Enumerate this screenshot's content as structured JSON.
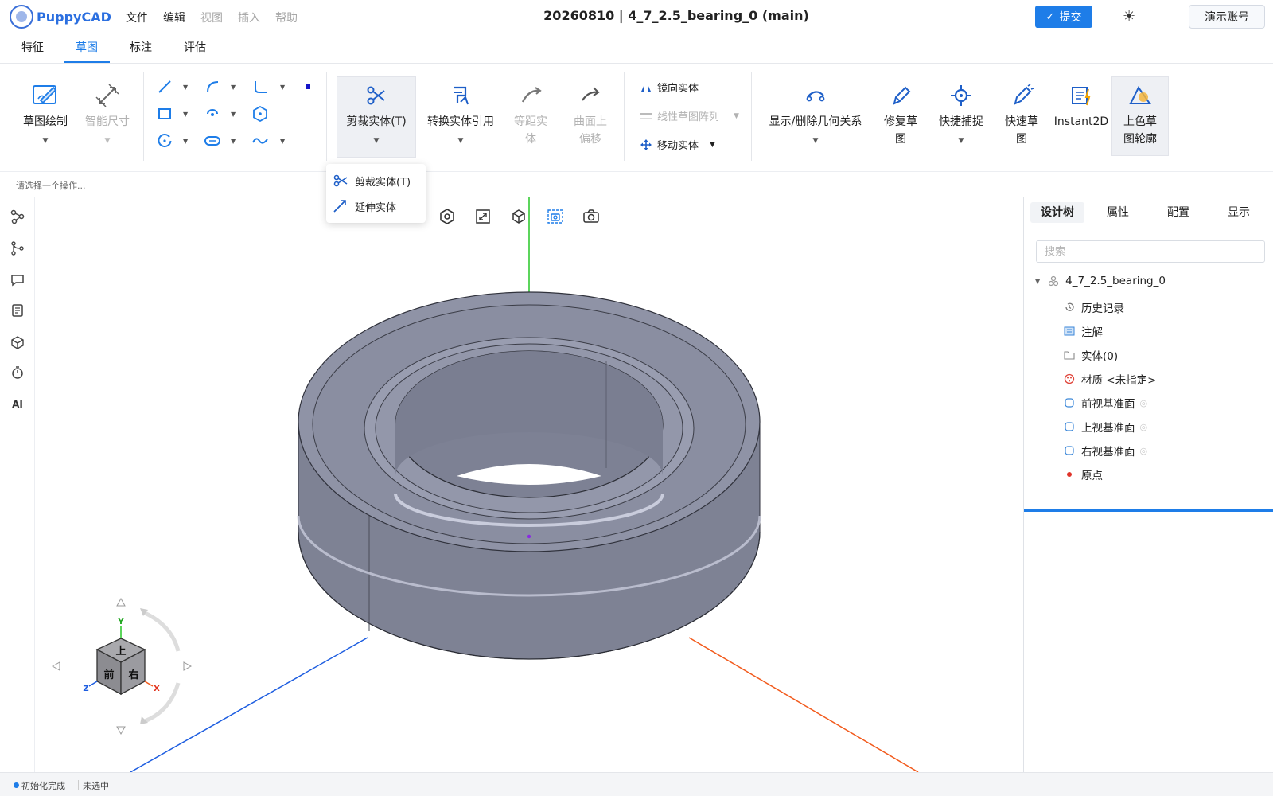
{
  "app": {
    "name": "PuppyCAD",
    "doc_title": "20260810 | 4_7_2.5_bearing_0  (main)"
  },
  "menu": [
    {
      "label": "文件",
      "enabled": true
    },
    {
      "label": "编辑",
      "enabled": true
    },
    {
      "label": "视图",
      "enabled": false
    },
    {
      "label": "插入",
      "enabled": false
    },
    {
      "label": "帮助",
      "enabled": false
    }
  ],
  "header": {
    "submit_label": "提交",
    "account_label": "演示账号",
    "theme_icon": "sun-icon"
  },
  "tabs": [
    {
      "label": "特征",
      "active": false
    },
    {
      "label": "草图",
      "active": true
    },
    {
      "label": "标注",
      "active": false
    },
    {
      "label": "评估",
      "active": false
    }
  ],
  "ribbon": {
    "sketch_draw": "草图绘制",
    "smart_dim": "智能尺寸",
    "trim": "剪裁实体(T)",
    "convert": "转换实体引用",
    "offset_line1": "等距实",
    "offset_line2": "体",
    "surface_line1": "曲面上",
    "surface_line2": "偏移",
    "mirror": "镜向实体",
    "linear_pattern": "线性草图阵列",
    "move": "移动实体",
    "relations": "显示/删除几何关系",
    "repair_line1": "修复草",
    "repair_line2": "图",
    "quick_snap": "快捷捕捉",
    "rapid_line1": "快速草",
    "rapid_line2": "图",
    "instant2d": "Instant2D",
    "colorize_line1": "上色草",
    "colorize_line2": "图轮廓"
  },
  "dropdown": {
    "items": [
      "剪裁实体(T)",
      "延伸实体"
    ]
  },
  "prompt": "请选择一个操作...",
  "left_tools": [
    "sketch-tree-icon",
    "branch-icon",
    "comment-icon",
    "list-icon",
    "part-icon",
    "timer-icon",
    "AI"
  ],
  "viewport": {
    "tools": [
      "view-orient-icon",
      "fit-icon",
      "cube-view-icon",
      "snapshot-region-icon",
      "camera-icon"
    ],
    "cube_labels": {
      "top": "上",
      "front": "前",
      "right": "右"
    },
    "axes": {
      "x": "X",
      "y": "Y",
      "z": "Z"
    }
  },
  "right_panel": {
    "tabs": [
      {
        "label": "设计树",
        "active": true
      },
      {
        "label": "属性",
        "active": false
      },
      {
        "label": "配置",
        "active": false
      },
      {
        "label": "显示",
        "active": false
      }
    ],
    "search_placeholder": "搜索",
    "root": "4_7_2.5_bearing_0",
    "nodes": [
      {
        "label": "历史记录",
        "icon": "history-icon"
      },
      {
        "label": "注解",
        "icon": "annotation-icon"
      },
      {
        "label": "实体(0)",
        "icon": "folder-icon"
      },
      {
        "label": "材质 <未指定>",
        "icon": "material-icon"
      },
      {
        "label": "前视基准面",
        "icon": "plane-icon"
      },
      {
        "label": "上视基准面",
        "icon": "plane-icon"
      },
      {
        "label": "右视基准面",
        "icon": "plane-icon"
      },
      {
        "label": "原点",
        "icon": "origin-icon"
      }
    ]
  },
  "status": {
    "left": "初始化完成",
    "right": "未选中"
  },
  "colors": {
    "accent": "#1e7de8",
    "part_fill": "#7c8193",
    "axis_x": "#f25a1c",
    "axis_y": "#26c726",
    "axis_z": "#1d5de0"
  }
}
